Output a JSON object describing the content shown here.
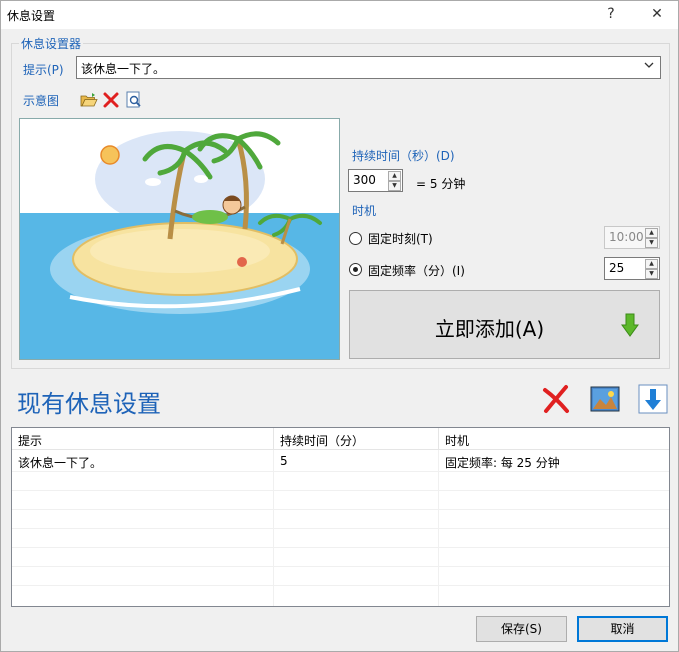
{
  "window": {
    "title": "休息设置",
    "help_label": "?",
    "close_label": "✕"
  },
  "group": {
    "label": "休息设置器"
  },
  "prompt": {
    "label": "提示(P)",
    "value": "该休息一下了。"
  },
  "thumbnail": {
    "label": "示意图"
  },
  "duration": {
    "label": "持续时间（秒）(D)",
    "value": "300",
    "equals_text": "= 5 分钟"
  },
  "timing": {
    "label": "时机",
    "fixed_time_label": "固定时刻(T)",
    "fixed_time_value": "10:00",
    "fixed_time_selected": false,
    "fixed_freq_label": "固定频率（分）(I)",
    "fixed_freq_value": "25",
    "fixed_freq_selected": true
  },
  "add_button": {
    "label": "立即添加(A)"
  },
  "existing": {
    "title": "现有休息设置",
    "columns": [
      "提示",
      "持续时间（分）",
      "时机"
    ],
    "rows": [
      [
        "该休息一下了。",
        "5",
        "固定频率: 每 25 分钟"
      ]
    ]
  },
  "footer": {
    "save_label": "保存(S)",
    "cancel_label": "取消"
  },
  "colors": {
    "accent_blue": "#1e63b8",
    "delete_red": "#e02020",
    "arrow_green": "#5cb82a",
    "download_blue": "#1f7fd6"
  },
  "icons": {
    "open": "folder-open-icon",
    "delete": "delete-icon",
    "preview": "preview-icon",
    "add_arrow": "down-arrow-icon",
    "remove_all": "delete-icon",
    "image": "image-icon",
    "download": "download-icon"
  }
}
